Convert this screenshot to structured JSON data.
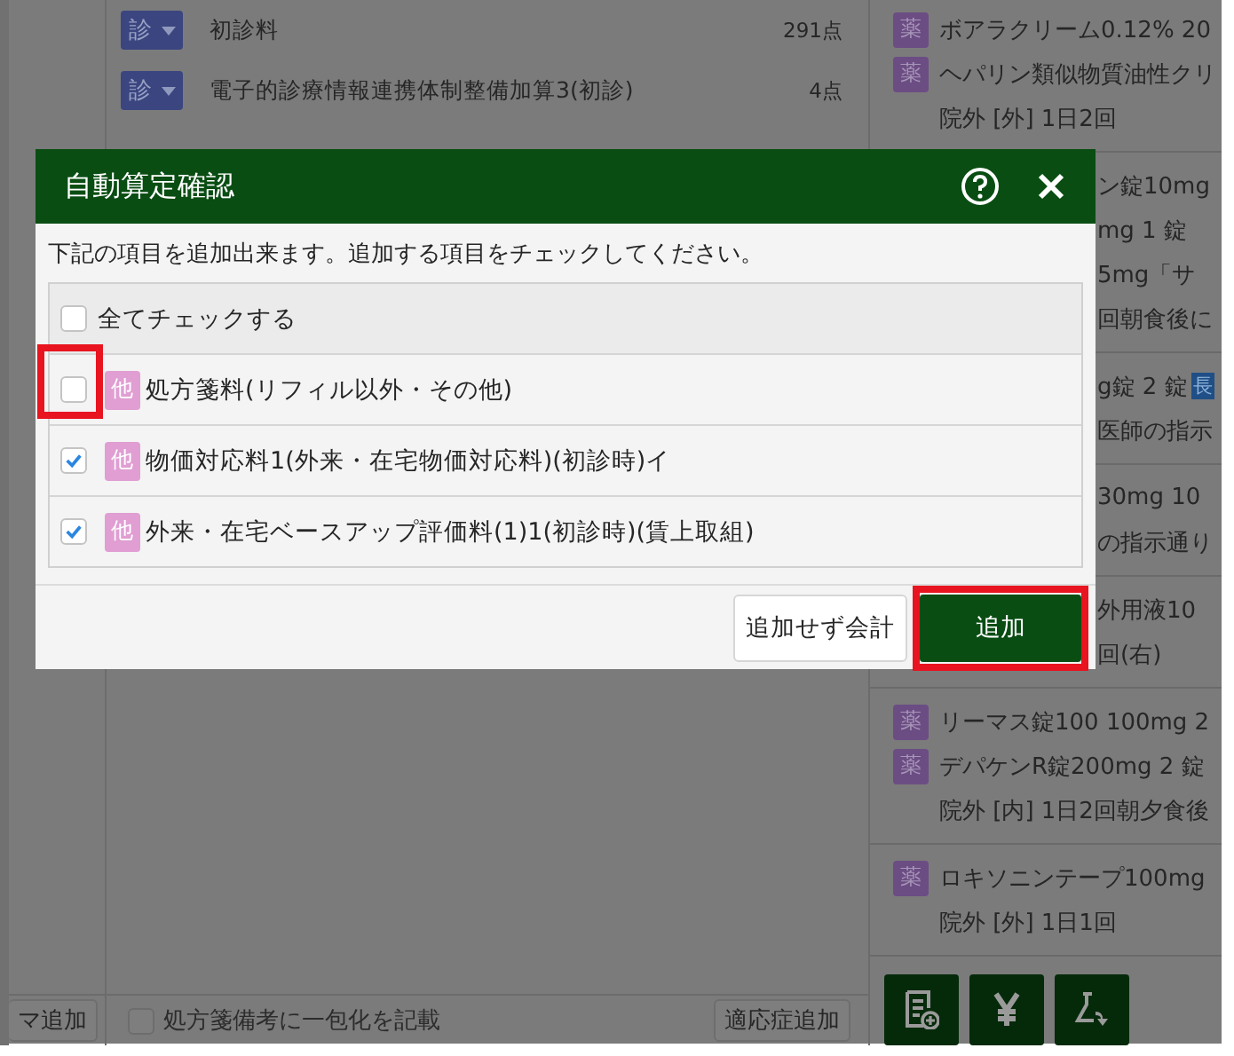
{
  "order_list": {
    "rows": [
      {
        "category": "診",
        "name": "初診料",
        "points": "291点"
      },
      {
        "category": "診",
        "name": "電子的診療情報連携体制整備加算3(初診)",
        "points": "4点"
      }
    ],
    "footer": {
      "checkbox": {
        "label": "処方箋備考に一包化を記載",
        "checked": false
      },
      "button": "適応症追加"
    }
  },
  "left_panel": {
    "button": "マ追加"
  },
  "right_panel": {
    "groups_top": [
      {
        "lines": [
          {
            "badge": "薬",
            "text": "ボアラクリーム0.12% 20"
          },
          {
            "badge": "薬",
            "text": "ヘパリン類似物質油性クリ"
          },
          {
            "text": "院外 [外] 1日2回"
          }
        ]
      }
    ],
    "groups_under_dialog": [
      {
        "lines": [
          {
            "text": "ン錠10mg"
          },
          {
            "text": "mg 1 錠"
          },
          {
            "text": "5mg「サ"
          },
          {
            "text": "回朝食後に"
          }
        ]
      },
      {
        "lines": [
          {
            "text": "g錠 2 錠",
            "tag": "長"
          },
          {
            "text": "医師の指示"
          }
        ]
      },
      {
        "lines": [
          {
            "text": "30mg 10"
          },
          {
            "text": "の指示通り"
          }
        ]
      },
      {
        "lines": [
          {
            "text": "外用液10"
          },
          {
            "text": "回(右)"
          }
        ]
      }
    ],
    "groups_bottom": [
      {
        "lines": [
          {
            "badge": "薬",
            "text": "リーマス錠100 100mg 2"
          },
          {
            "badge": "薬",
            "text": "デパケンR錠200mg 2 錠"
          },
          {
            "text": "院外 [内] 1日2回朝夕食後"
          }
        ]
      },
      {
        "lines": [
          {
            "badge": "薬",
            "text": "ロキソニンテープ100mg"
          },
          {
            "text": "院外 [外] 1日1回"
          }
        ]
      }
    ],
    "tool_buttons": [
      {
        "kind": "sheet-add"
      },
      {
        "kind": "yen"
      },
      {
        "kind": "flask-arrow"
      }
    ]
  },
  "dialog": {
    "title": "自動算定確認",
    "instruction": "下記の項目を追加出来ます。追加する項目をチェックしてください。",
    "check_all": {
      "label": "全てチェックする",
      "checked": false
    },
    "items": [
      {
        "category": "他",
        "name": "処方箋料(リフィル以外・その他)",
        "checked": false,
        "highlighted": true
      },
      {
        "category": "他",
        "name": "物価対応料1(外来・在宅物価対応料)(初診時)イ",
        "checked": true,
        "highlighted": false
      },
      {
        "category": "他",
        "name": "外来・在宅ベースアップ評価料(1)1(初診時)(賃上取組)",
        "checked": true,
        "highlighted": false
      }
    ],
    "buttons": [
      {
        "label": "追加せず会計",
        "kind": "secondary",
        "highlighted": false
      },
      {
        "label": "追加",
        "kind": "primary",
        "highlighted": true
      }
    ]
  }
}
